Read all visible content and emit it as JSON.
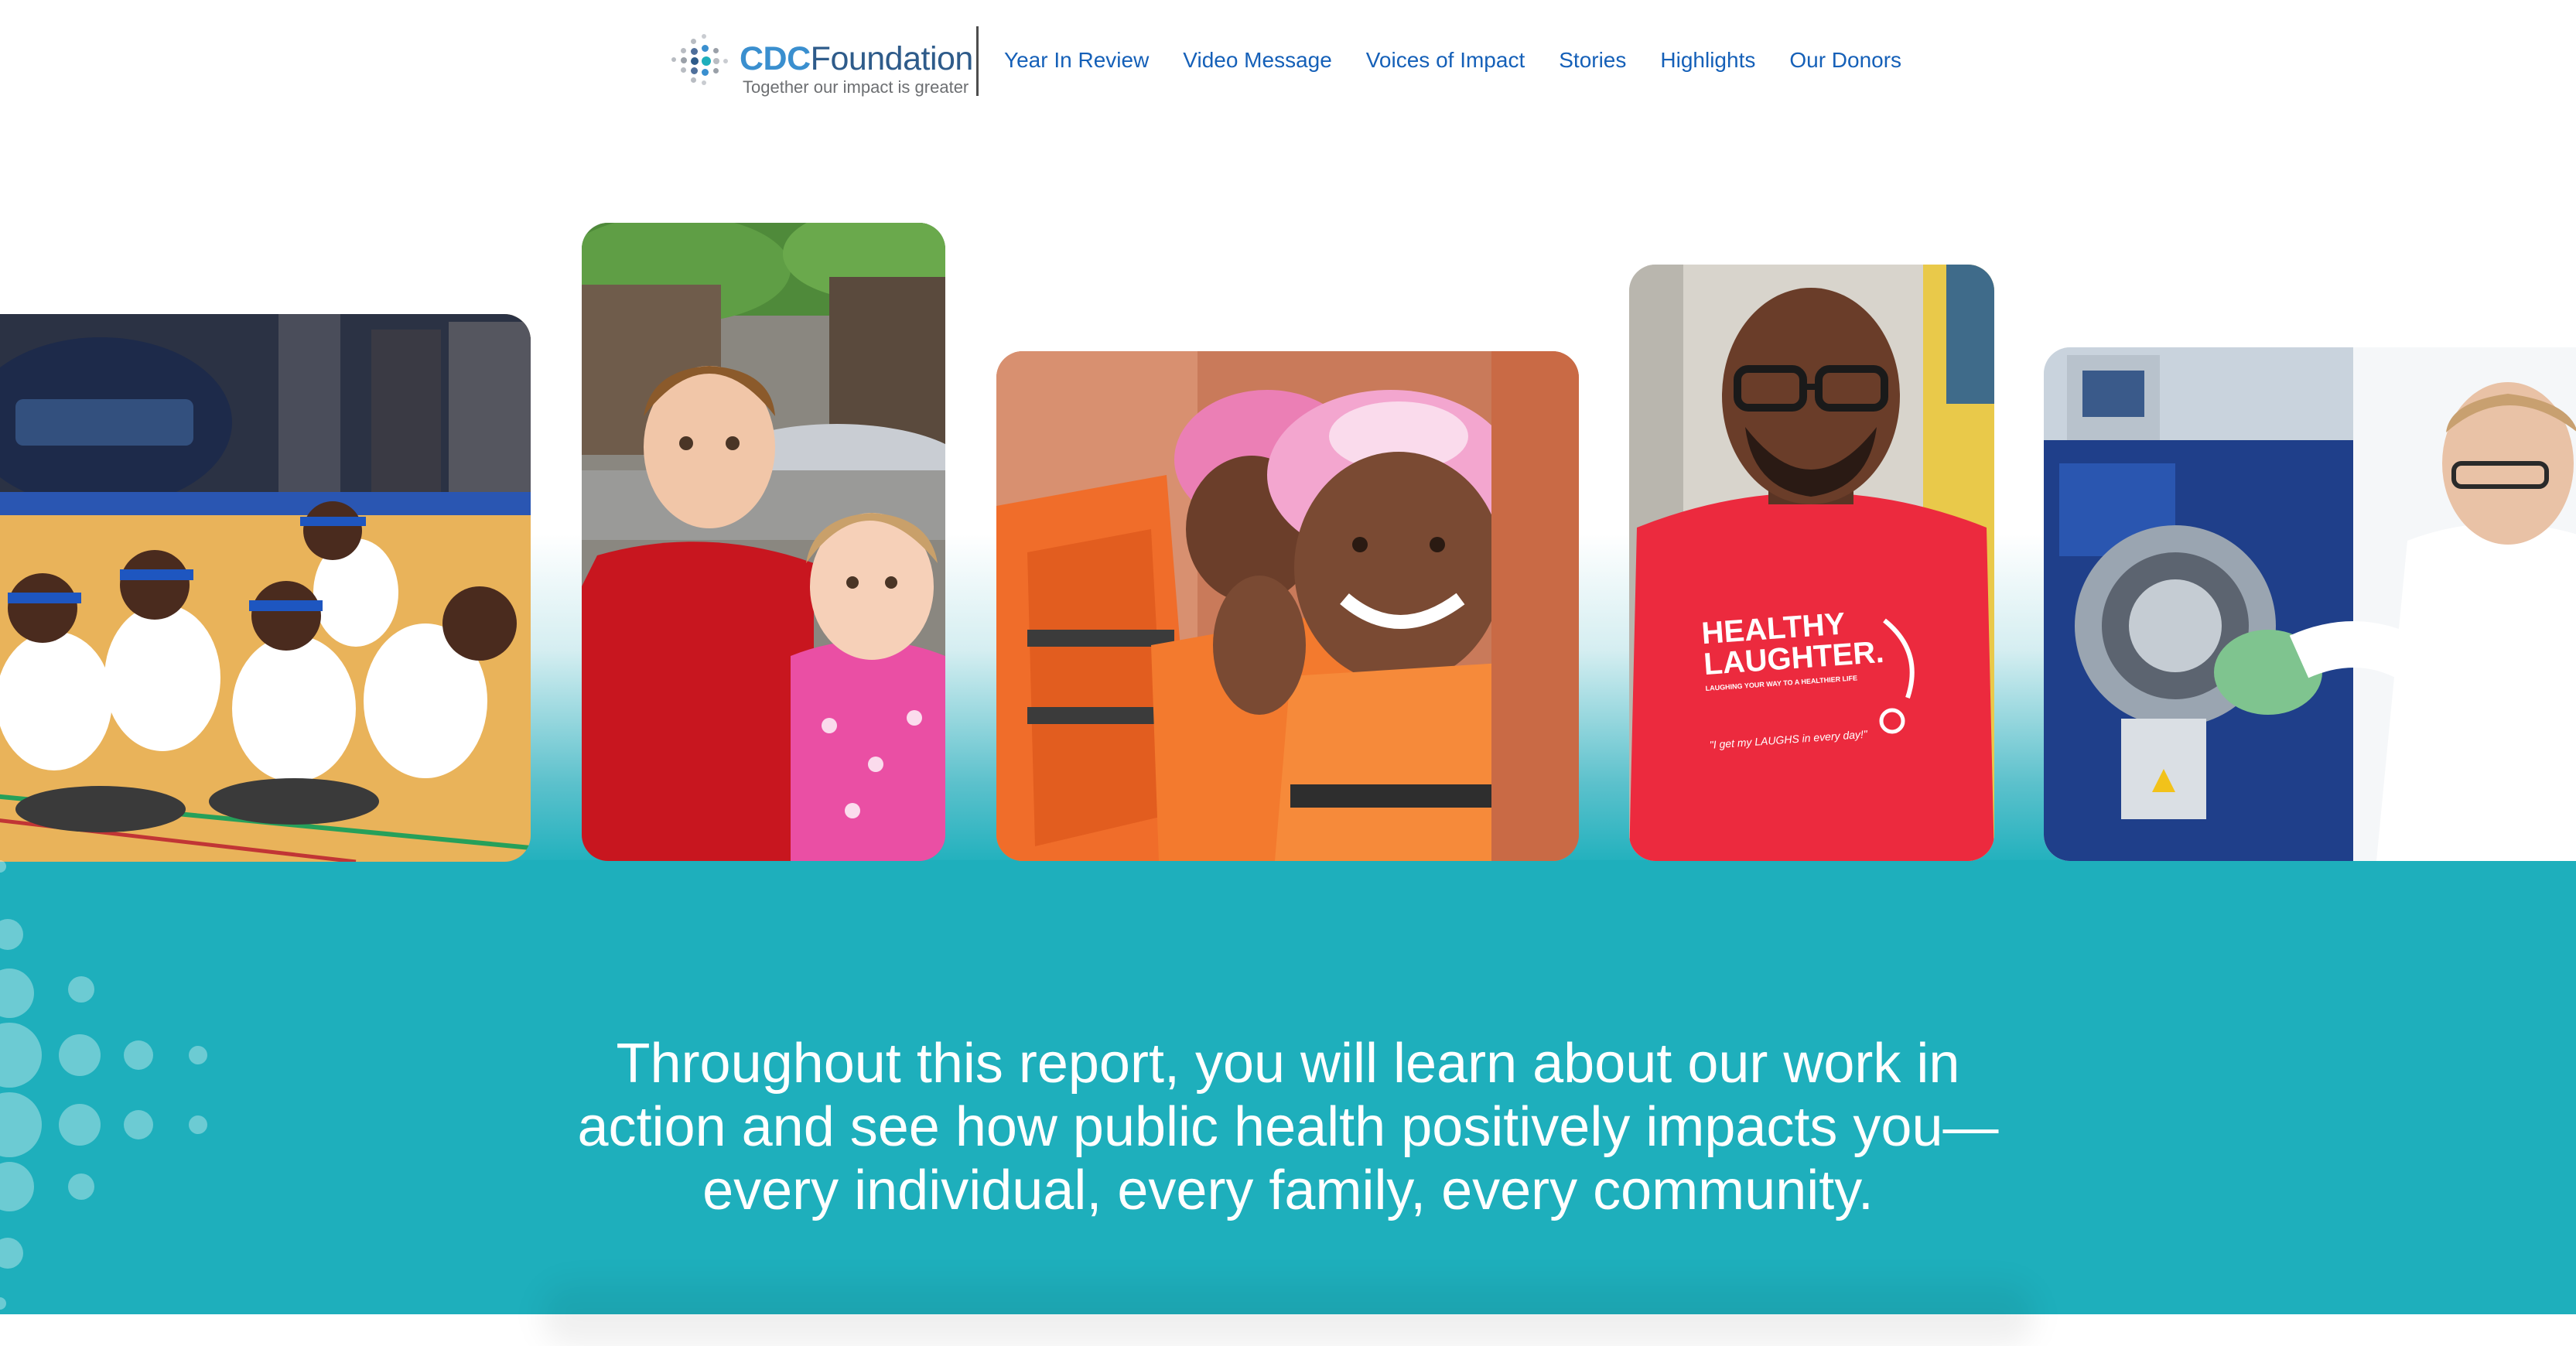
{
  "header": {
    "logo": {
      "brand_primary": "CDC",
      "brand_secondary": "Foundation",
      "tagline": "Together our impact is greater"
    },
    "nav": [
      {
        "label": "Year In Review"
      },
      {
        "label": "Video Message"
      },
      {
        "label": "Voices of Impact"
      },
      {
        "label": "Stories"
      },
      {
        "label": "Highlights"
      },
      {
        "label": "Our Donors"
      }
    ]
  },
  "photos": [
    {
      "subject": "children-sitting-on-gym-floor"
    },
    {
      "subject": "boy-and-girl-outdoors"
    },
    {
      "subject": "smiling-girl-in-life-vest"
    },
    {
      "subject": "man-in-healthy-laughter-shirt",
      "shirt_text": "HEALTHY LAUGHTER.",
      "shirt_tagline": "LAUGHING YOUR WAY TO A HEALTHIER LIFE",
      "shirt_quote": "\"I get my LAUGHS in every day!\""
    },
    {
      "subject": "scientist-with-lab-equipment"
    }
  ],
  "intro": {
    "text": "Throughout this report, you will learn about our work in action and see how public health positively impacts you—every individual, every family, every community."
  },
  "colors": {
    "teal": "#1eafbc",
    "nav_link": "#1560b8",
    "logo_blue": "#3a8fcf"
  }
}
